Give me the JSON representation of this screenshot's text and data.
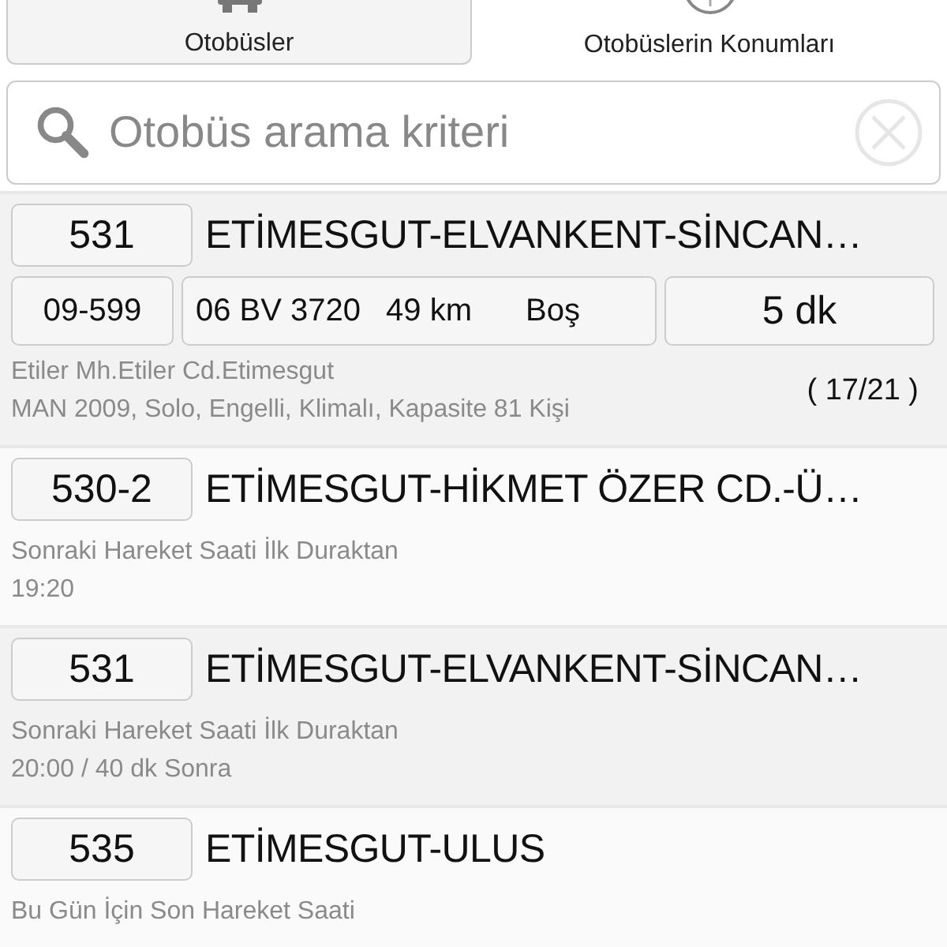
{
  "tabs": [
    {
      "label": "Otobüsler",
      "selected": true
    },
    {
      "label": "Otobüslerin Konumları",
      "selected": false
    }
  ],
  "search": {
    "placeholder": "Otobüs arama kriteri"
  },
  "routes": [
    {
      "kind": "live",
      "code": "531",
      "name": "ETİMESGUT-ELVANKENT-SİNCAN…",
      "vehicle": "09-599",
      "plate": "06 BV 3720",
      "distance": "49 km",
      "occupancy": "Boş",
      "eta": "5 dk",
      "location": "Etiler Mh.Etiler Cd.Etimesgut",
      "details": "MAN 2009, Solo, Engelli, Klimalı, Kapasite 81 Kişi",
      "stop_count": "( 17/21 )"
    },
    {
      "kind": "schedule",
      "code": "530-2",
      "name": "ETİMESGUT-HİKMET ÖZER CD.-Ü…",
      "label": "Sonraki Hareket Saati İlk Duraktan",
      "time": "19:20"
    },
    {
      "kind": "schedule",
      "code": "531",
      "name": "ETİMESGUT-ELVANKENT-SİNCAN…",
      "label": "Sonraki Hareket Saati İlk Duraktan",
      "time": "20:00 / 40 dk Sonra"
    },
    {
      "kind": "schedule",
      "code": "535",
      "name": "ETİMESGUT-ULUS",
      "label": "Bu Gün İçin Son Hareket Saati"
    }
  ]
}
